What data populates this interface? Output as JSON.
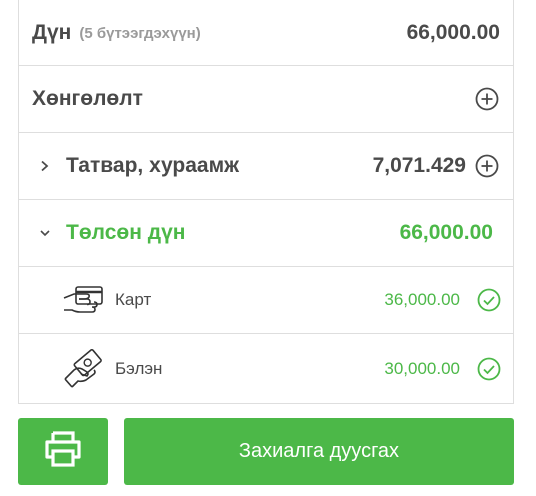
{
  "summary": {
    "total_label": "Дүн",
    "total_items": "(5 бүтээгдэхүүн)",
    "total_value": "66,000.00",
    "discount_label": "Хөнгөлөлт",
    "tax_label": "Татвар, хураамж",
    "tax_value": "7,071.429",
    "paid_label": "Төлсөн дүн",
    "paid_value": "66,000.00"
  },
  "payments": [
    {
      "label": "Карт",
      "value": "36,000.00",
      "icon": "card-payment-icon"
    },
    {
      "label": "Бэлэн",
      "value": "30,000.00",
      "icon": "cash-payment-icon"
    }
  ],
  "actions": {
    "print_icon": "printer-icon",
    "finish_label": "Захиалга дуусгах"
  },
  "colors": {
    "accent": "#4cb848",
    "text": "#4a4a4a",
    "muted": "#9a9a9a",
    "border": "#dedede"
  }
}
